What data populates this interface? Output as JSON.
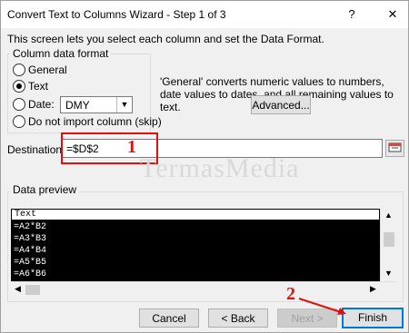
{
  "window": {
    "title": "Convert Text to Columns Wizard - Step 1 of 3",
    "help": "?",
    "close": "✕"
  },
  "intro_text": "This screen lets you select each column and set the Data Format.",
  "column_format": {
    "group_label": "Column data format",
    "options": [
      {
        "label": "General",
        "checked": false
      },
      {
        "label": "Text",
        "checked": true
      },
      {
        "label": "Date:",
        "checked": false
      },
      {
        "label": "Do not import column (skip)",
        "checked": false
      }
    ],
    "date_format": "DMY"
  },
  "description": "'General' converts numeric values to numbers, date values to dates, and all remaining values to text.",
  "advanced_button": "Advanced...",
  "destination": {
    "label": "Destination:",
    "value": "=$D$2"
  },
  "watermark": "TermasMedia",
  "preview": {
    "group_label": "Data preview",
    "header": "Text",
    "rows": [
      "=A2*B2",
      "=A3*B3",
      "=A4*B4",
      "=A5*B5",
      "=A6*B6"
    ]
  },
  "buttons": {
    "cancel": "Cancel",
    "back": "< Back",
    "next": "Next >",
    "finish": "Finish"
  },
  "annotations": {
    "one": "1",
    "two": "2"
  },
  "colors": {
    "annotation": "#e01010",
    "primary_border": "#0078d7",
    "preview_bg": "#000000"
  }
}
